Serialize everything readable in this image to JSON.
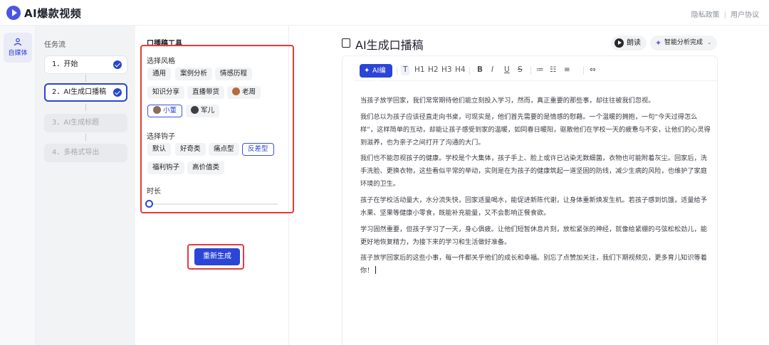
{
  "app": {
    "title": "AI爆款视频"
  },
  "top_links": {
    "privacy": "隐私政策",
    "separator": "|",
    "agreement": "用户协议"
  },
  "rail": {
    "item_label": "自媒体"
  },
  "flow": {
    "title": "任务流",
    "steps": [
      {
        "label": "1．开始",
        "state": "done"
      },
      {
        "label": "2．AI生成口播稿",
        "state": "active-done"
      },
      {
        "label": "3．AI生成标题",
        "state": "disabled"
      },
      {
        "label": "4．多格式导出",
        "state": "disabled"
      }
    ]
  },
  "tools": {
    "title": "口播稿工具",
    "style_label": "选择风格",
    "styles": [
      "通用",
      "案例分析",
      "情感历程",
      "知识分享",
      "直播带货",
      "老周",
      "小董",
      "军儿"
    ],
    "selected_style": "小董",
    "hook_label": "选择钩子",
    "hooks": [
      "默认",
      "好奇类",
      "痛点型",
      "反差型",
      "福利钩子",
      "高价值类"
    ],
    "selected_hook": "反差型",
    "duration_label": "时长",
    "duration_value_fraction": 0.0,
    "regenerate_label": "重新生成"
  },
  "editor": {
    "title": "AI生成口播稿",
    "read_label": "朗读",
    "status_label": "智能分析完成",
    "toolbar": {
      "ai_edit": "AI编辑",
      "items": [
        "T",
        "H1",
        "H2",
        "H3",
        "H4",
        "B",
        "I",
        "U",
        "S",
        "≔",
        "☷",
        "≡",
        "⇔"
      ]
    },
    "paragraphs": [
      "当孩子放学回家，我们常常期待他们能立刻投入学习，然而，真正重要的那些事，却往往被我们忽视。",
      "我们总以为孩子应该径直走向书桌，可现实是，他们首先需要的是情感的慰藉。一个温暖的拥抱，一句“今天过得怎么样”，这样简单的互动，却能让孩子感受到家的温暖，如同春日暖阳，驱散他们在学校一天的疲惫与不安，让他们的心灵得到滋养，也为亲子之间打开了沟通的大门。",
      "我们也不能忽视孩子的健康。学校是个大集体，孩子手上、脸上或许已沾染无数细菌，衣物也可能附着灰尘。回家后，洗手洗脸、更换衣物，这些看似平常的举动，实则是在为孩子的健康筑起一道坚固的防线，减少生病的风险，也维护了家庭环境的卫生。",
      "孩子在学校活动量大，水分流失快，回家适量喝水，能促进新陈代谢，让身体重新焕发生机。若孩子感到饥饿，适量给予水果、坚果等健康小零食，既能补充能量，又不会影响正餐食欲。",
      "学习固然重要，但孩子学习了一天，身心俱疲。让他们短暂休息片刻，放松紧张的神经，就像给紧绷的弓弦松松劲儿，能更好地恢复精力，为接下来的学习和生活做好准备。",
      "孩子放学回家后的这些小事，每一件都关乎他们的成长和幸福。别忘了点赞加关注，我们下期视频见，更多育儿知识等着你！"
    ]
  },
  "colors": {
    "accent": "#2b45d6",
    "highlight_box": "#e23b3b"
  }
}
